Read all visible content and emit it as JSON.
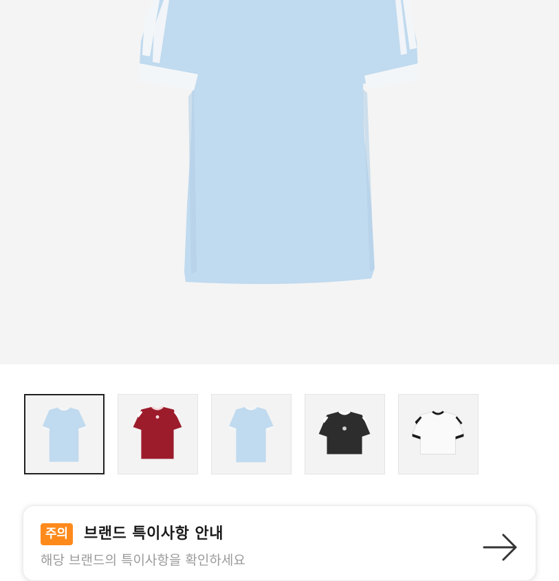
{
  "product": {
    "main_image": "light-blue-three-stripe-tshirt",
    "colors": {
      "light_blue": "#c0daef",
      "white_trim": "#f4f6f7",
      "burgundy": "#9c1c2c",
      "black": "#2d2d2d",
      "white": "#fafafa"
    }
  },
  "thumbnails": [
    {
      "name": "light-blue-tee",
      "selected": true
    },
    {
      "name": "burgundy-tee",
      "selected": false
    },
    {
      "name": "light-blue-tee-alt",
      "selected": false
    },
    {
      "name": "black-crop-tee",
      "selected": false
    },
    {
      "name": "white-crop-tee",
      "selected": false
    }
  ],
  "notice": {
    "badge": "주의",
    "title": "브랜드 특이사항 안내",
    "description": "해당 브랜드의 특이사항을 확인하세요",
    "arrow_icon": "arrow-right-icon"
  }
}
